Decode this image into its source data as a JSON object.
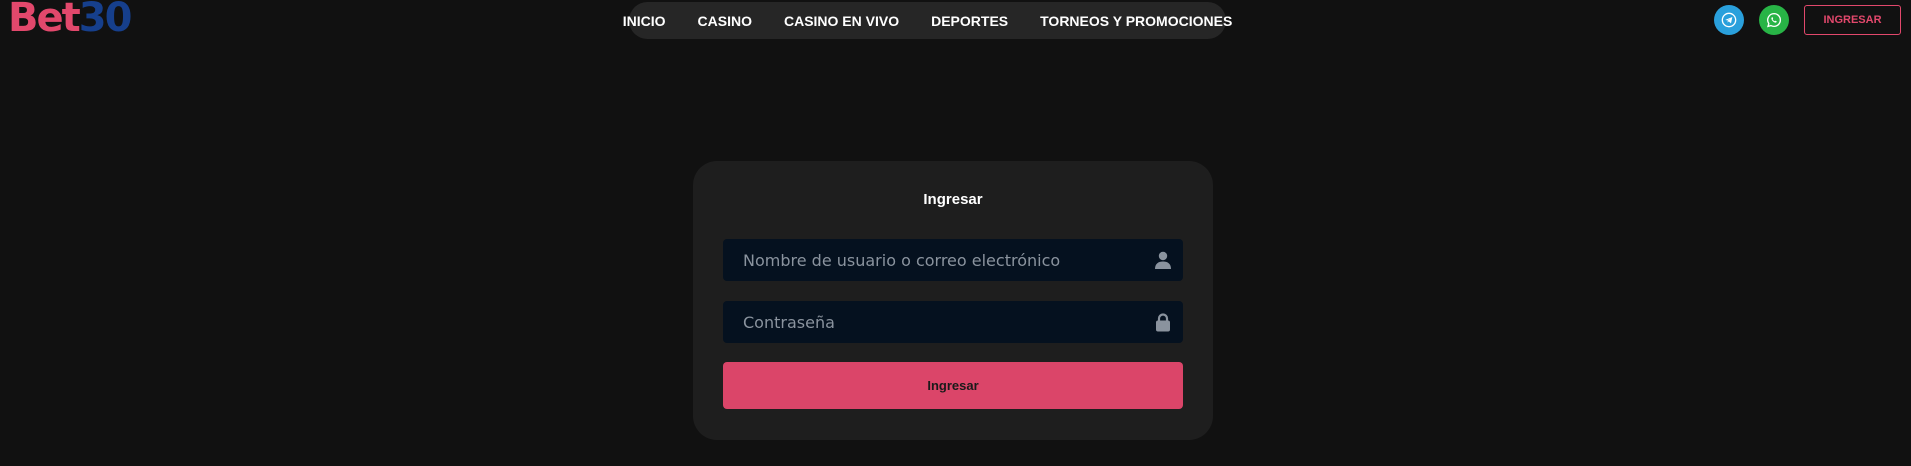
{
  "brand": {
    "logo_part1": "Bet",
    "logo_part2": "30",
    "color_primary": "#e2486c",
    "color_secondary": "#163f8c"
  },
  "nav": {
    "items": [
      {
        "label": "INICIO"
      },
      {
        "label": "CASINO"
      },
      {
        "label": "CASINO EN VIVO"
      },
      {
        "label": "DEPORTES"
      },
      {
        "label": "TORNEOS Y PROMOCIONES"
      }
    ]
  },
  "header_actions": {
    "telegram_icon": "telegram-icon",
    "whatsapp_icon": "whatsapp-icon",
    "login_label": "INGRESAR"
  },
  "login_form": {
    "title": "Ingresar",
    "username_placeholder": "Nombre de usuario o correo electrónico",
    "username_value": "",
    "username_icon": "user-icon",
    "password_placeholder": "Contraseña",
    "password_value": "",
    "password_icon": "lock-icon",
    "submit_label": "Ingresar",
    "submit_color": "#db4569"
  }
}
